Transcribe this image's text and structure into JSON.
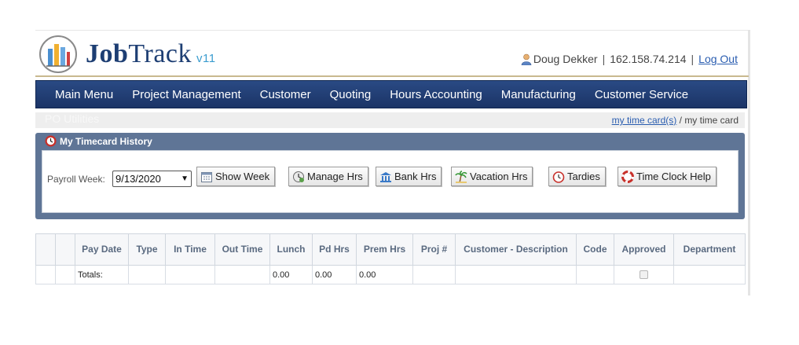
{
  "header": {
    "logo_primary": "Job",
    "logo_secondary": "Track",
    "version": "v11",
    "user_name": "Doug Dekker",
    "separator": "|",
    "ip_address": "162.158.74.214",
    "logout_label": "Log Out"
  },
  "nav": {
    "items": [
      "Main Menu",
      "Project Management",
      "Customer",
      "Quoting",
      "Hours Accounting",
      "Manufacturing",
      "Customer Service"
    ]
  },
  "subbar": {
    "ghost_text": "PO Utilities",
    "crumb_link": "my time card(s)",
    "crumb_sep": " / ",
    "crumb_current": "my time card"
  },
  "panel": {
    "title": "My Timecard History",
    "payroll_label": "Payroll Week:",
    "payroll_value": "9/13/2020",
    "buttons": {
      "show_week": "Show Week",
      "manage_hrs": "Manage Hrs",
      "bank_hrs": "Bank Hrs",
      "vacation_hrs": "Vacation Hrs",
      "tardies": "Tardies",
      "time_clock_help": "Time Clock Help"
    }
  },
  "table": {
    "headers": [
      "",
      "",
      "Pay Date",
      "Type",
      "In Time",
      "Out Time",
      "Lunch",
      "Pd Hrs",
      "Prem Hrs",
      "Proj #",
      "Customer - Description",
      "Code",
      "Approved",
      "Department"
    ],
    "totals_row": {
      "label": "Totals:",
      "lunch": "0.00",
      "pd_hrs": "0.00",
      "prem_hrs": "0.00",
      "approved_checked": false
    }
  },
  "colors": {
    "nav_bg": "#1f3b74",
    "panel_bg": "#5f7596",
    "link": "#2a5db0",
    "header_rule": "#c9b98f",
    "logo_blue": "#1d3e73"
  }
}
